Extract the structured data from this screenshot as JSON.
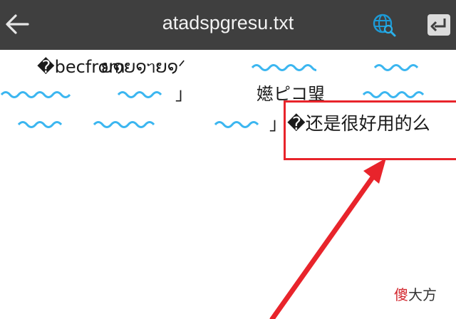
{
  "header": {
    "title": "atadspgresu.txt",
    "back_icon": "arrow-left-icon",
    "encoding_icon": "globe-search-icon",
    "enter_icon": "enter-key-icon"
  },
  "content": {
    "garbled": [
      "�becfrom",
      "ຍ໑ຍ໑ᥐຍ໑ᐟ",
      "」",
      "嬨ピコ琞",
      "」",
      "�还是很好用的么"
    ]
  },
  "watermark": {
    "accent_char": "傻",
    "rest": "大方"
  },
  "colors": {
    "titlebar": "#3f3f3f",
    "wave": "#3bb6f0",
    "highlight": "#e8242b"
  }
}
